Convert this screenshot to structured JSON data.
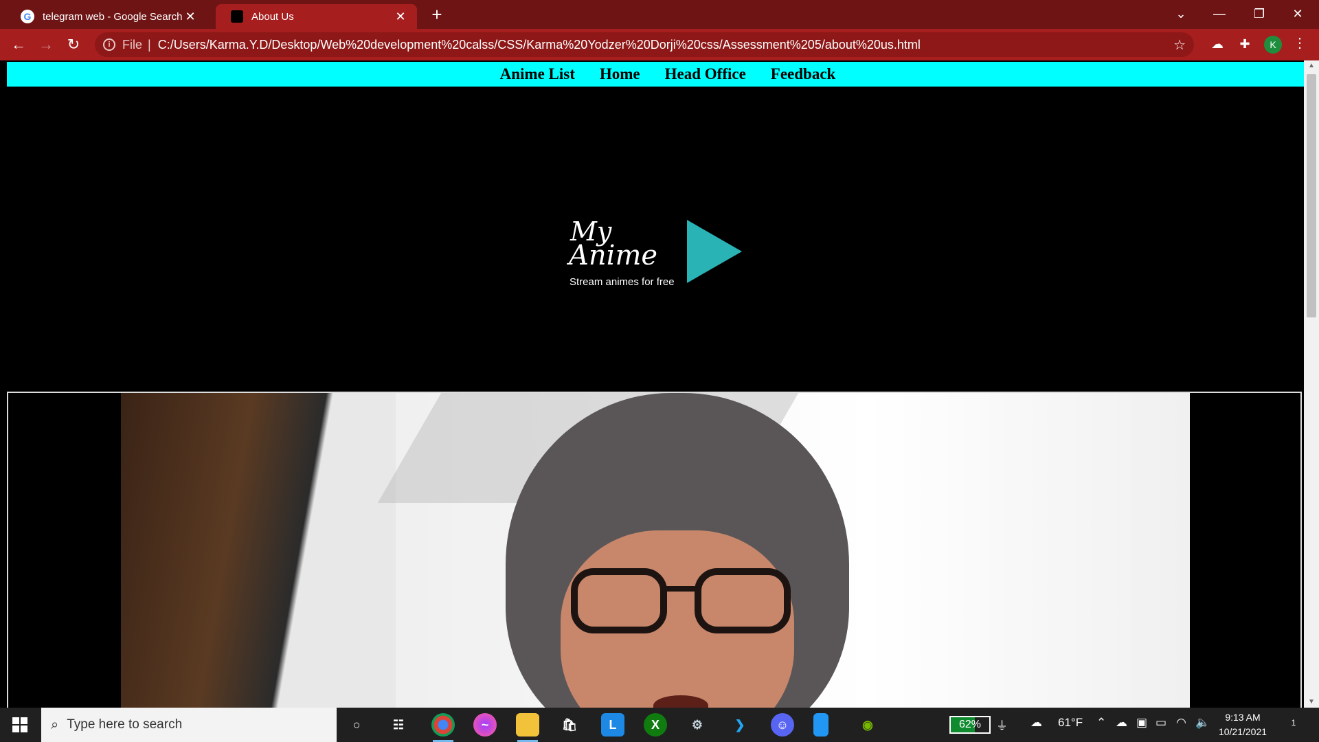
{
  "browser": {
    "tabs": [
      {
        "title": "telegram web - Google Search",
        "favicon": "google-g-icon",
        "active": false
      },
      {
        "title": "About Us",
        "favicon": "site-icon",
        "active": true
      }
    ],
    "new_tab_symbol": "+",
    "address": {
      "scheme": "File",
      "url": "C:/Users/Karma.Y.D/Desktop/Web%20development%20calss/CSS/Karma%20Yodzer%20Dorji%20css/Assessment%205/about%20us.html"
    },
    "profile_initial": "K",
    "colors": {
      "tabbar": "#6e1414",
      "toolbar": "#a61e1e"
    }
  },
  "site": {
    "nav": [
      {
        "label": "Anime List"
      },
      {
        "label": "Home"
      },
      {
        "label": "Head Office"
      },
      {
        "label": "Feedback"
      }
    ],
    "logo": {
      "line1": "My",
      "line2": "Anime",
      "tagline": "Stream animes for free",
      "play_color": "#29b3b5"
    },
    "colors": {
      "nav_bg": "#00ffff",
      "page_bg": "#000000"
    }
  },
  "taskbar": {
    "search_placeholder": "Type here to search",
    "apps": [
      {
        "name": "cortana-icon"
      },
      {
        "name": "task-view-icon"
      },
      {
        "name": "chrome-icon"
      },
      {
        "name": "messenger-icon"
      },
      {
        "name": "file-explorer-icon"
      },
      {
        "name": "store-icon"
      },
      {
        "name": "l-app-icon"
      },
      {
        "name": "xbox-icon"
      },
      {
        "name": "steam-icon"
      },
      {
        "name": "vscode-icon"
      },
      {
        "name": "discord-icon"
      },
      {
        "name": "blue-app-icon"
      },
      {
        "name": "nvidia-icon"
      }
    ],
    "battery": "62%",
    "battery_level": 0.62,
    "weather": "61°F",
    "time": "9:13 AM",
    "date": "10/21/2021",
    "notification_count": "1"
  }
}
